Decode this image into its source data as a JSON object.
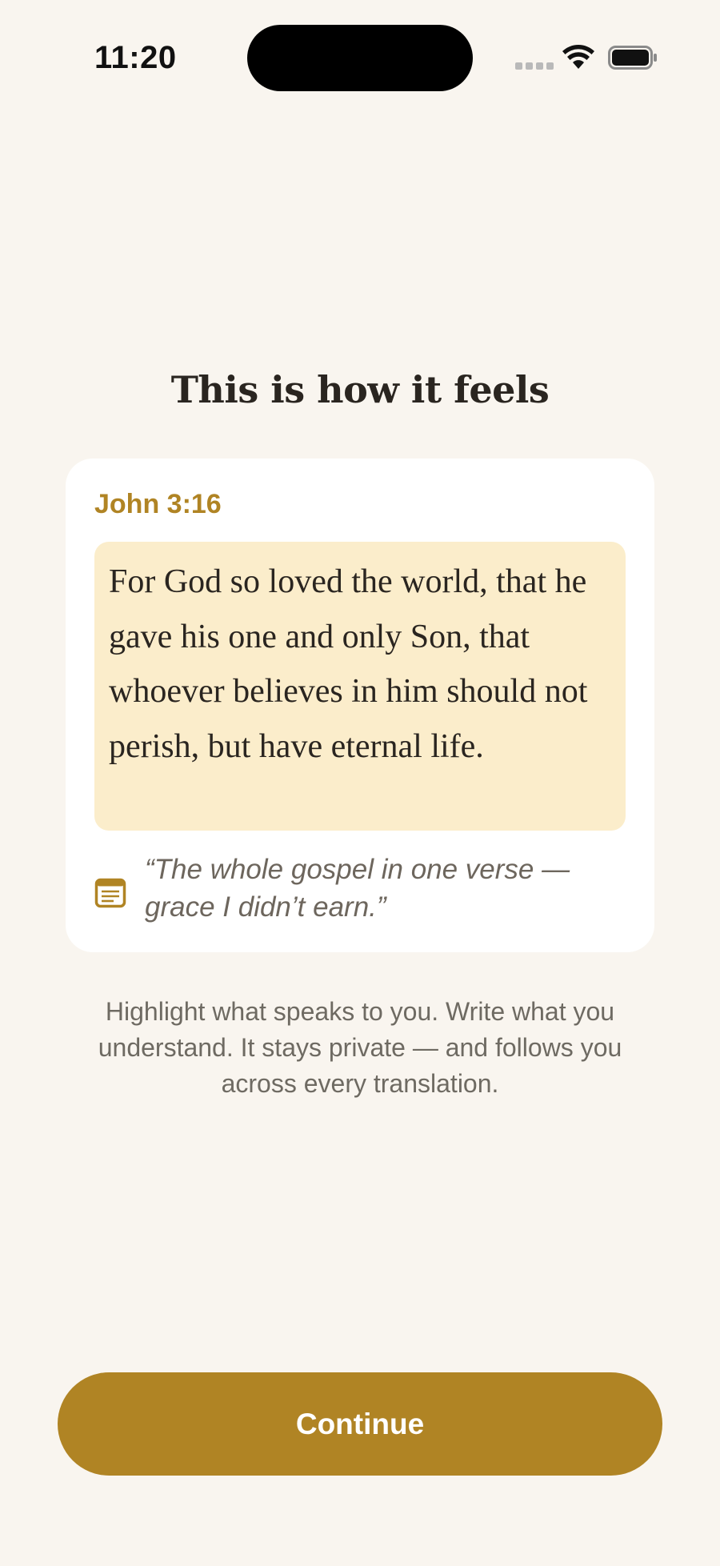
{
  "status_bar": {
    "time": "11:20"
  },
  "onboarding": {
    "title": "This is how it feels",
    "card": {
      "verse_reference": "John 3:16",
      "verse_text": "For God so loved the world, that he gave his one and only Son, that whoever believes in him should not perish, but have eternal life.",
      "note_icon": "note-icon",
      "note_text": "“The whole gospel in one verse — grace I didn’t earn.”"
    },
    "description": "Highlight what speaks to you. Write what you understand. It stays private — and follows you across every translation.",
    "continue_label": "Continue"
  },
  "colors": {
    "background": "#f9f5ef",
    "accent": "#b08424",
    "highlight": "#fbedcb",
    "card": "#ffffff",
    "text_dark": "#2a2520",
    "text_muted": "#6e6a62"
  }
}
